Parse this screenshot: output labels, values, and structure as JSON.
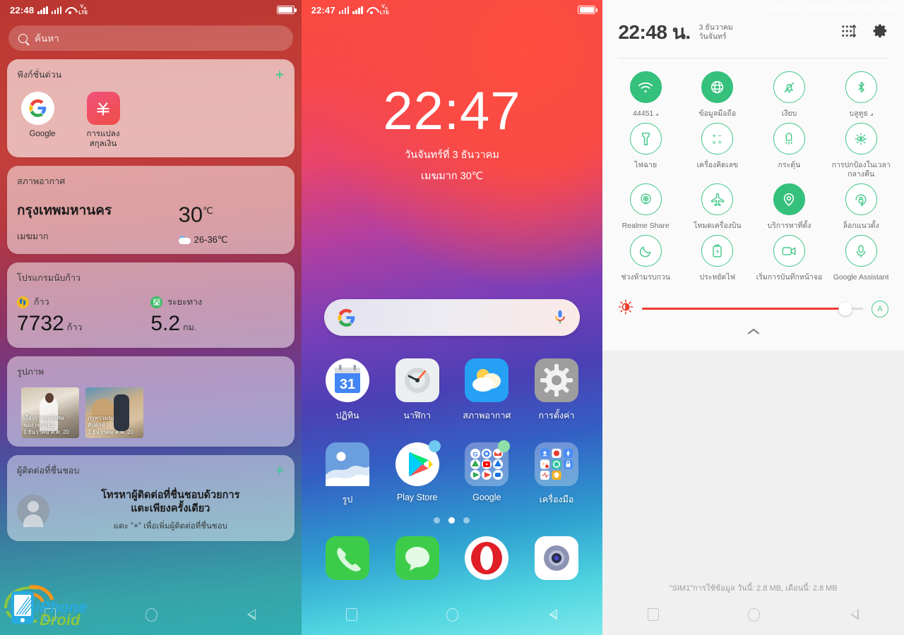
{
  "panel1": {
    "name": "smart-assistant-screen",
    "statusbar": {
      "time": "22:48",
      "network": "VoLTE",
      "battery_icon": "battery-icon"
    },
    "search": {
      "placeholder": "ค้นหา",
      "icon": "search-icon"
    },
    "quick_functions": {
      "title": "ฟังก์ชั่นด่วน",
      "add_label": "+",
      "items": [
        {
          "label": "Google",
          "icon": "google-icon"
        },
        {
          "label": "การแปลง\nสกุลเงิน",
          "label_line1": "การแปลง",
          "label_line2": "สกุลเงิน",
          "icon": "currency-converter-icon"
        }
      ]
    },
    "weather": {
      "title": "สภาพอากาศ",
      "city": "กรุงเทพมหานคร",
      "description": "เมฆมาก",
      "temperature": "30",
      "unit": "℃",
      "range": "26-36℃",
      "condition_icon": "partly-cloudy-icon"
    },
    "steps": {
      "title": "โปรแกรมนับก้าว",
      "steps_label": "ก้าว",
      "steps_value": "7732",
      "steps_unit": "ก้าว",
      "distance_label": "ระยะทาง",
      "distance_value": "5.2",
      "distance_unit": "กม."
    },
    "photos": {
      "title": "รูปภาพ",
      "items": [
        {
          "caption_line1": "เรื่องราวสุดพิเศษ",
          "caption_line2": "ของ เขา/เธอ",
          "caption_line3": "1 ธันวาคม ค.ศ. 20"
        },
        {
          "caption_line1": "ภาพรวมของ",
          "caption_line2": "สัปดาห์",
          "caption_line3": "1 ธันวาคม ค.ศ. 20"
        }
      ]
    },
    "contacts": {
      "title": "ผู้ติดต่อที่ชื่นชอบ",
      "add_label": "+",
      "headline_line1": "โทรหาผู้ติดต่อที่ชื่นชอบด้วยการ",
      "headline_line2": "แตะเพียงครั้งเดียว",
      "subtext": "แตะ \"+\" เพื่อเพิ่มผู้ติดต่อที่ชื่นชอบ"
    },
    "watermark": {
      "line1": "iPhone",
      "line2": "Droid"
    }
  },
  "panel2": {
    "name": "home-screen",
    "statusbar": {
      "time": "22:47",
      "network": "VoLTE"
    },
    "clock": {
      "time": "22:47",
      "date": "วันจันทร์ที่ 3 ธันวาคม",
      "weather": "เมฆมาก 30℃"
    },
    "google_search": {
      "left_icon": "google-icon",
      "right_icon": "microphone-icon"
    },
    "apps": [
      {
        "label": "ปฏิทิน",
        "icon": "calendar-icon",
        "day": "31"
      },
      {
        "label": "นาฬิกา",
        "icon": "clock-icon"
      },
      {
        "label": "สภาพอากาศ",
        "icon": "weather-icon"
      },
      {
        "label": "การตั้งค่า",
        "icon": "settings-gear-icon"
      },
      {
        "label": "รูป",
        "icon": "photos-icon"
      },
      {
        "label": "Play Store",
        "icon": "play-store-icon",
        "badge": true
      },
      {
        "label": "Google",
        "icon": "google-folder-icon",
        "badge": true
      },
      {
        "label": "เครื่องมือ",
        "icon": "tools-folder-icon"
      }
    ],
    "page_dots": {
      "count": 3,
      "active_index": 1
    },
    "dock": [
      {
        "icon": "phone-icon"
      },
      {
        "icon": "messages-icon"
      },
      {
        "icon": "opera-browser-icon"
      },
      {
        "icon": "camera-icon"
      }
    ]
  },
  "panel3": {
    "name": "quick-settings-panel",
    "watermark_top": "www.iphone-droid.net",
    "header": {
      "time": "22:48 น.",
      "date_line1": "3 ธันวาคม",
      "date_line2": "วันจันทร์",
      "edit_icon": "reorder-tiles-icon",
      "settings_icon": "gear-icon"
    },
    "toggles": [
      {
        "label": "44451",
        "icon": "wifi-icon",
        "active": true,
        "caret": true
      },
      {
        "label": "ข้อมูลมือถือ",
        "icon": "mobile-data-globe-icon",
        "active": true,
        "caret": false
      },
      {
        "label": "เงียบ",
        "icon": "silent-bell-icon",
        "active": false,
        "caret": false
      },
      {
        "label": "บลูทูธ",
        "icon": "bluetooth-icon",
        "active": false,
        "caret": true
      },
      {
        "label": "ไฟฉาย",
        "icon": "flashlight-icon",
        "active": false,
        "caret": false
      },
      {
        "label": "เครื่องคิดเลข",
        "icon": "calculator-icon",
        "active": false,
        "caret": false
      },
      {
        "label": "กระตุ้น",
        "icon": "vibration-icon",
        "active": false,
        "caret": false
      },
      {
        "label": "การปกป้องในเวลากลางคืน",
        "icon": "night-shield-eye-icon",
        "active": false,
        "caret": false
      },
      {
        "label": "Realme Share",
        "icon": "realme-share-icon",
        "active": false,
        "caret": false
      },
      {
        "label": "โหมดเครื่องบิน",
        "icon": "airplane-icon",
        "active": false,
        "caret": false
      },
      {
        "label": "บริการหาที่ตั้ง",
        "icon": "location-pin-icon",
        "active": true,
        "caret": false
      },
      {
        "label": "ล็อกแนวตั้ง",
        "icon": "rotation-lock-icon",
        "active": false,
        "caret": false
      },
      {
        "label": "ช่วงห้ามรบกวน",
        "icon": "moon-dnd-icon",
        "active": false,
        "caret": false
      },
      {
        "label": "ประหยัดไฟ",
        "icon": "battery-saver-icon",
        "active": false,
        "caret": false
      },
      {
        "label": "เริ่มการบันทึกหน้าจอ",
        "icon": "screen-record-icon",
        "active": false,
        "caret": false
      },
      {
        "label": "Google Assistant",
        "icon": "microphone-icon",
        "active": false,
        "caret": false
      }
    ],
    "brightness": {
      "icon": "brightness-icon",
      "value_percent": 92,
      "auto_label": "A",
      "accent_color": "#ef3b2d"
    },
    "expand_icon": "chevron-up-icon",
    "data_usage": "\"SIM1\"การใช้ข้อมูล วันนี้: 2.8 MB, เดือนนี้: 2.8 MB"
  },
  "navbar": {
    "recents_icon": "recents-square-icon",
    "home_icon": "home-circle-icon",
    "back_icon": "back-triangle-icon"
  }
}
